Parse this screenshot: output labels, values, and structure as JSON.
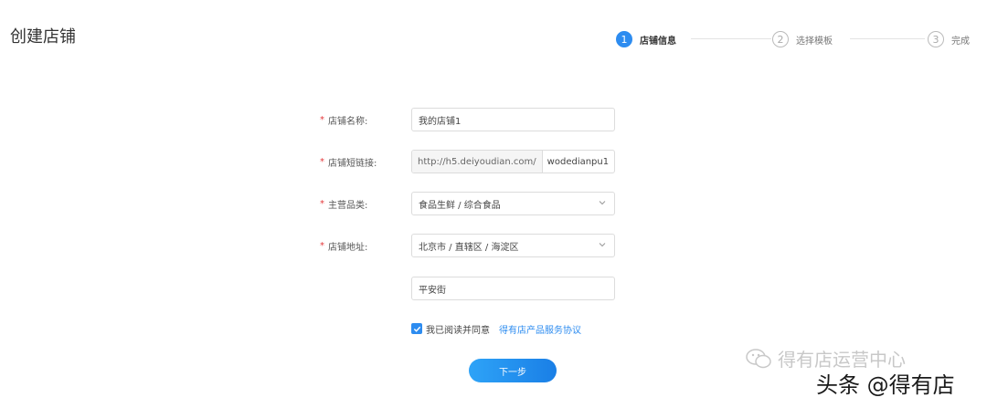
{
  "page": {
    "title": "创建店铺"
  },
  "steps": [
    {
      "num": "1",
      "label": "店铺信息",
      "active": true
    },
    {
      "num": "2",
      "label": "选择模板",
      "active": false
    },
    {
      "num": "3",
      "label": "完成",
      "active": false
    }
  ],
  "form": {
    "name": {
      "label": "店铺名称:",
      "value": "我的店铺1"
    },
    "link": {
      "label": "店铺短链接:",
      "prefix": "http://h5.deiyoudian.com/",
      "value": "wodedianpu1"
    },
    "category": {
      "label": "主营品类:",
      "value": "食品生鲜 / 综合食品"
    },
    "address": {
      "label": "店铺地址:",
      "value": "北京市 / 直辖区 / 海淀区"
    },
    "street": {
      "value": "平安街"
    },
    "required_mark": "*"
  },
  "agreement": {
    "text": "我已阅读并同意",
    "link": "得有店产品服务协议",
    "checked": true
  },
  "next_button": "下一步",
  "watermark": {
    "line1": "得有店运营中心",
    "line2": "头条 @得有店"
  },
  "colors": {
    "accent": "#2d8cf0",
    "required": "#e4393c"
  }
}
